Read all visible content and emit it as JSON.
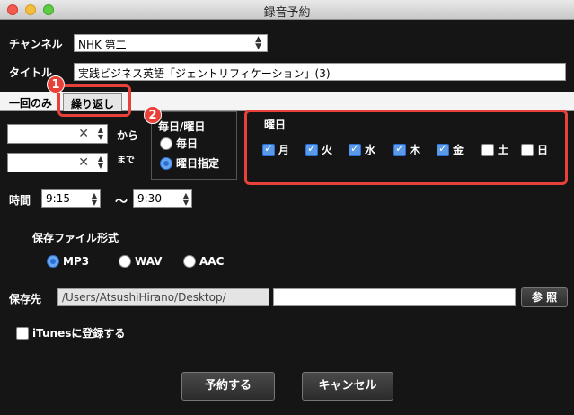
{
  "window": {
    "title": "録音予約"
  },
  "channel": {
    "label": "チャンネル",
    "value": "NHK 第二"
  },
  "title_field": {
    "label": "タイトル",
    "value": "実践ビジネス英語「ジェントリフィケーション」(3)"
  },
  "tabs": [
    {
      "label": "一回のみ",
      "selected": false
    },
    {
      "label": "繰り返し",
      "selected": true
    }
  ],
  "callouts": {
    "one": "1",
    "two": "2"
  },
  "date_range": {
    "from_suffix": "から",
    "to_suffix": "まで"
  },
  "repeat_mode": {
    "title": "毎日/曜日",
    "options": [
      {
        "label": "毎日",
        "selected": false
      },
      {
        "label": "曜日指定",
        "selected": true
      }
    ]
  },
  "weekdays": {
    "title": "曜日",
    "days": [
      {
        "label": "月",
        "checked": true
      },
      {
        "label": "火",
        "checked": true
      },
      {
        "label": "水",
        "checked": true
      },
      {
        "label": "木",
        "checked": true
      },
      {
        "label": "金",
        "checked": true
      },
      {
        "label": "土",
        "checked": false
      },
      {
        "label": "日",
        "checked": false
      }
    ]
  },
  "time": {
    "label": "時間",
    "start": "9:15",
    "separator": "〜",
    "end": "9:30"
  },
  "file_format": {
    "title": "保存ファイル形式",
    "options": [
      {
        "label": "MP3",
        "selected": true
      },
      {
        "label": "WAV",
        "selected": false
      },
      {
        "label": "AAC",
        "selected": false
      }
    ]
  },
  "save_dest": {
    "label": "保存先",
    "path": "/Users/AtsushiHirano/Desktop/",
    "extra": "",
    "browse_label": "参 照"
  },
  "itunes": {
    "label": "iTunesに登録する",
    "checked": false
  },
  "buttons": {
    "reserve": "予約する",
    "cancel": "キャンセル"
  },
  "colors": {
    "accent_red": "#e8413a",
    "background": "#151515"
  }
}
